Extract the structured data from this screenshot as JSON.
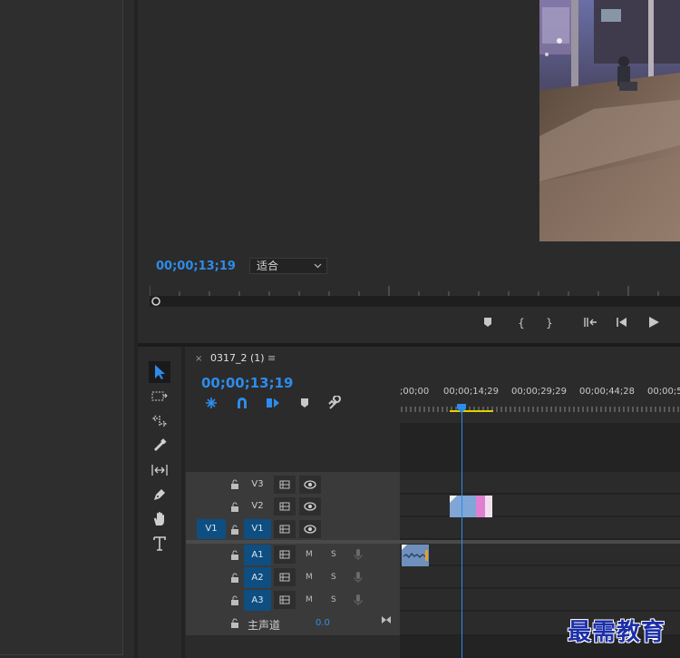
{
  "program_monitor": {
    "timecode": "00;00;13;19",
    "fit_select": {
      "value": "适合",
      "icon": "chevron-down-icon"
    },
    "controls": {
      "add_marker": "marker-icon",
      "mark_in": "{",
      "mark_out": "}",
      "go_to_in": "go-to-in-icon",
      "step_back": "step-back-icon",
      "play": "play-icon"
    }
  },
  "tools": [
    "selection-tool-icon",
    "track-select-tool-icon",
    "ripple-edit-tool-icon",
    "razor-tool-icon",
    "slip-tool-icon",
    "pen-tool-icon",
    "hand-tool-icon",
    "type-tool-icon"
  ],
  "timeline": {
    "tab_close": "×",
    "sequence_name": "0317_2 (1)",
    "tab_menu": "≡",
    "timecode": "00;00;13;19",
    "ruler_labels": [
      ";00;00",
      "00;00;14;29",
      "00;00;29;29",
      "00;00;44;28",
      "00;00;5"
    ],
    "video_tracks": [
      {
        "target": "",
        "name": "V3"
      },
      {
        "target": "",
        "name": "V2"
      },
      {
        "target": "V1",
        "name": "V1"
      }
    ],
    "audio_tracks": [
      {
        "name": "A1",
        "mute": "M",
        "solo": "S"
      },
      {
        "name": "A2",
        "mute": "M",
        "solo": "S"
      },
      {
        "name": "A3",
        "mute": "M",
        "solo": "S"
      }
    ],
    "master": {
      "label": "主声道",
      "value": "0.0"
    }
  },
  "watermark": "最需教育",
  "colors": {
    "accent_blue": "#2d8ceb",
    "track_target": "#0e4e81",
    "clip_video": "#7fa6d6",
    "clip_pink": "#e07fd0",
    "work_area": "#e0d000"
  }
}
